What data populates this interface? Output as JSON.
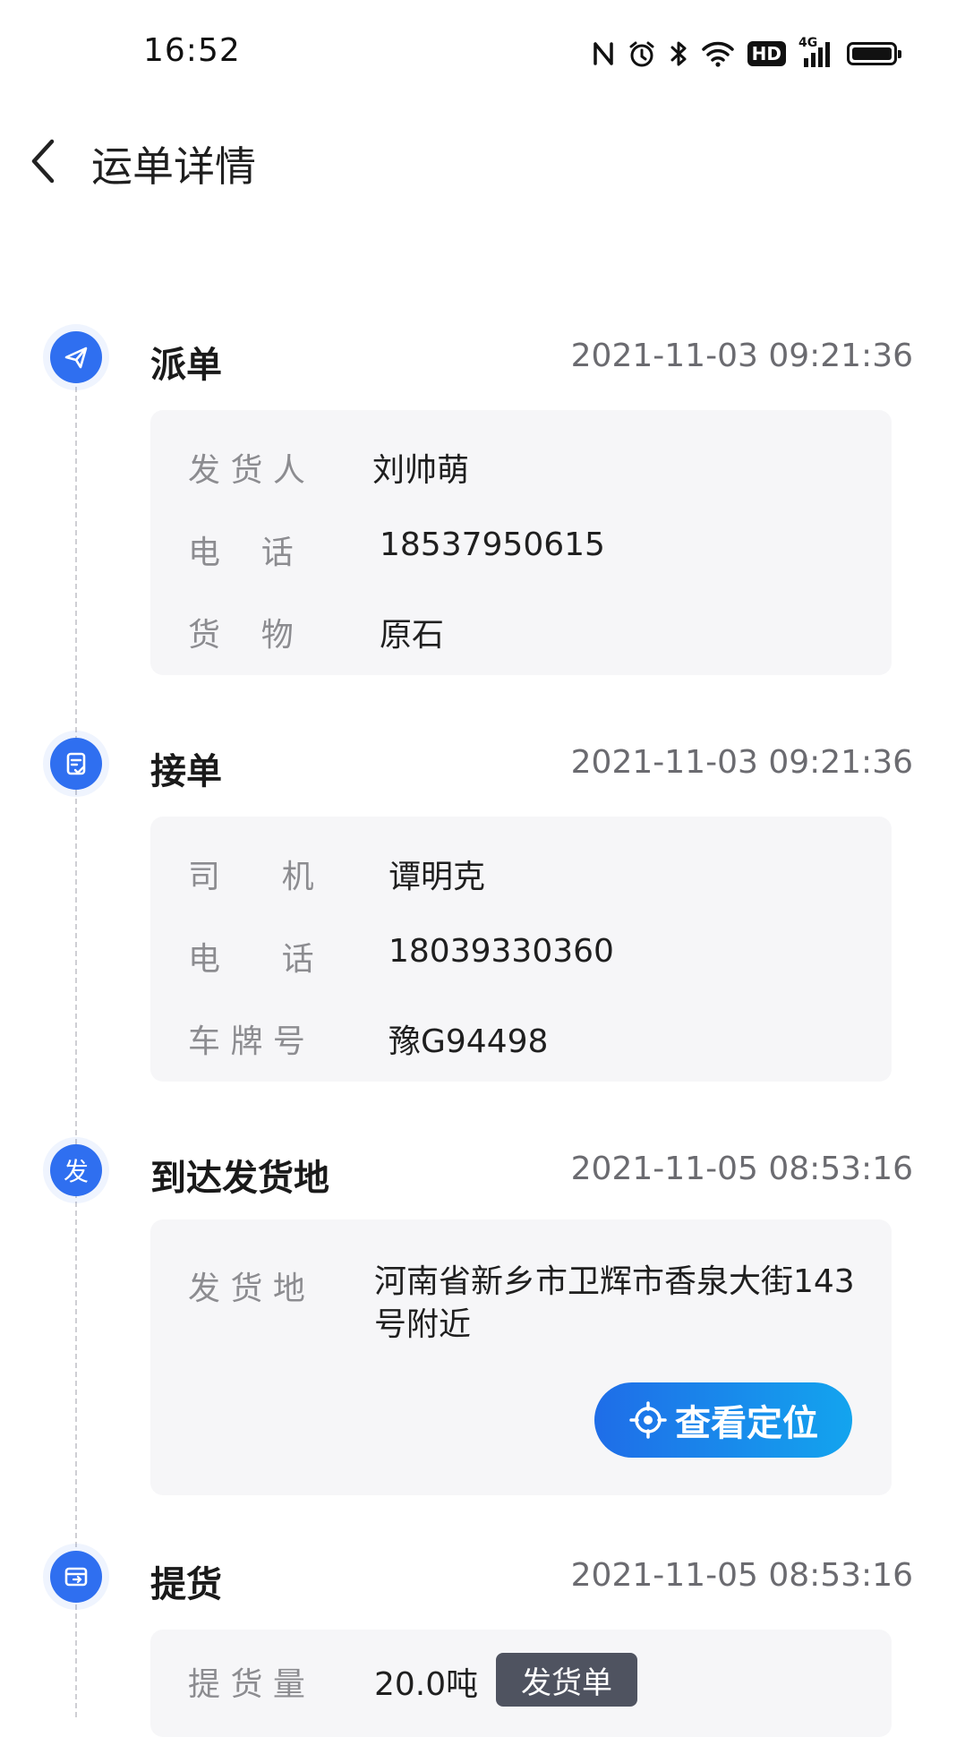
{
  "status_bar": {
    "time": "16:52",
    "icons": [
      "nfc-icon",
      "alarm-icon",
      "bluetooth-icon",
      "wifi-icon",
      "hd-icon",
      "signal-4g-icon",
      "battery-icon"
    ],
    "hd": "HD",
    "network": "4G"
  },
  "header": {
    "title": "运单详情",
    "back_icon": "chevron-left-icon"
  },
  "colors": {
    "accent": "#2f6ff0",
    "button_gradient_start": "#1f6de8",
    "button_gradient_end": "#13a4ee",
    "tag_bg": "#4f5360",
    "card_bg": "#f6f6f8",
    "label": "#8c8c90",
    "time": "#6b6b70"
  },
  "timeline": [
    {
      "title": "派单",
      "time": "2021-11-03 09:21:36",
      "icon": "send-icon",
      "rows": [
        {
          "label": "发 货 人",
          "value": "刘帅萌"
        },
        {
          "label": "电    话",
          "value": "18537950615"
        },
        {
          "label": "货    物",
          "value": "原石"
        }
      ]
    },
    {
      "title": "接单",
      "time": "2021-11-03 09:21:36",
      "icon": "order-check-icon",
      "rows": [
        {
          "label": "司      机",
          "value": "谭明克"
        },
        {
          "label": "电      话",
          "value": "18039330360"
        },
        {
          "label": "车 牌 号",
          "value": "豫G94498"
        }
      ]
    },
    {
      "title": "到达发货地",
      "time": "2021-11-05 08:53:16",
      "icon_text": "发",
      "rows": [
        {
          "label": "发 货 地",
          "value": "河南省新乡市卫辉市香泉大街143号附近"
        }
      ],
      "button": {
        "label": "查看定位",
        "icon": "locate-icon"
      }
    },
    {
      "title": "提货",
      "time": "2021-11-05 08:53:16",
      "icon": "pickup-icon",
      "rows": [
        {
          "label": "提 货 量",
          "value": "20.0吨"
        }
      ],
      "tag": "发货单"
    }
  ]
}
